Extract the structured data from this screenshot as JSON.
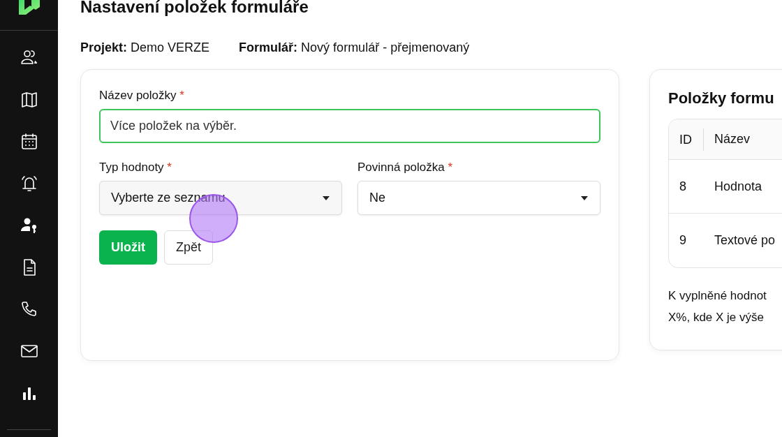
{
  "page_title": "Nastavení položek formuláře",
  "info": [
    {
      "label": "Projekt:",
      "value": "Demo VERZE"
    },
    {
      "label": "Formulář:",
      "value": "Nový formulář - přejmenovaný"
    }
  ],
  "form": {
    "fields": [
      {
        "kind": "text",
        "label": "Název položky",
        "required_marker": "*",
        "value": "Více položek na výběr.",
        "valid": true
      },
      {
        "kind": "select",
        "label": "Typ hodnoty",
        "required_marker": "*",
        "placeholder": "Vyberte ze seznamu"
      },
      {
        "kind": "select",
        "label": "Povinná položka",
        "required_marker": "*",
        "value": "Ne"
      }
    ],
    "buttons": [
      {
        "label": "Uložit",
        "kind": "primary"
      },
      {
        "label": "Zpět",
        "kind": "secondary"
      }
    ]
  },
  "items_panel": {
    "title": "Položky formu",
    "table": {
      "columns": [
        "ID",
        "Název"
      ],
      "rows": [
        [
          "8",
          "Hodnota"
        ],
        [
          "9",
          "Textové po"
        ]
      ]
    },
    "note_lines": [
      "K vyplněné hodnot",
      "X%, kde X je výše"
    ]
  }
}
